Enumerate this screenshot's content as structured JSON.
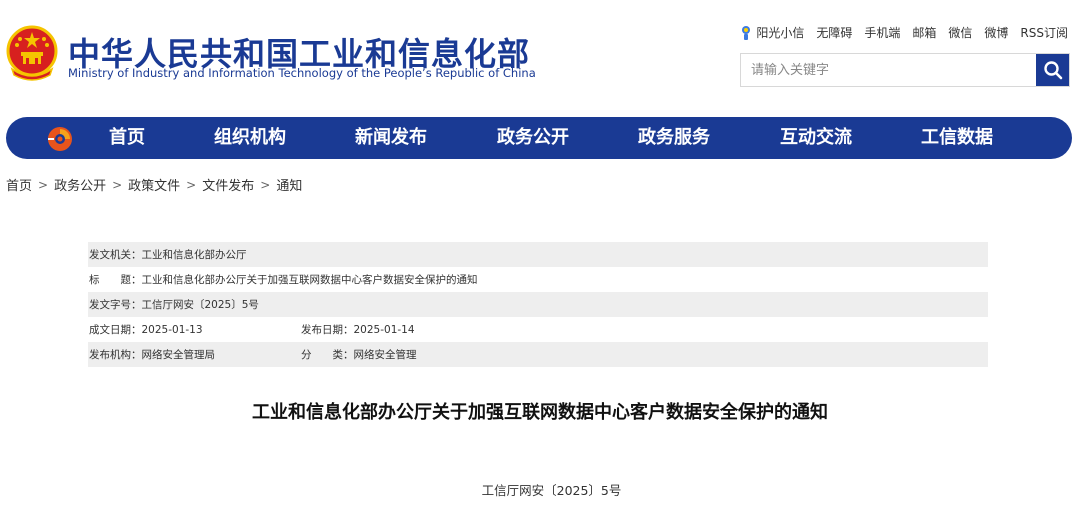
{
  "header": {
    "site_title": "中华人民共和国工业和信息化部",
    "site_subtitle": "Ministry of Industry and Information Technology of the People’s Republic of China",
    "top_links": [
      "阳光小信",
      "无障碍",
      "手机端",
      "邮箱",
      "微信",
      "微博",
      "RSS订阅"
    ],
    "search_placeholder": "请输入关键字"
  },
  "nav": {
    "items": [
      "首页",
      "组织机构",
      "新闻发布",
      "政务公开",
      "政务服务",
      "互动交流",
      "工信数据"
    ]
  },
  "breadcrumb": [
    "首页",
    "政务公开",
    "政策文件",
    "文件发布",
    "通知"
  ],
  "meta": {
    "issuer": "发文机关：工业和信息化部办公厅",
    "title": "标　　题：工业和信息化部办公厅关于加强互联网数据中心客户数据安全保护的通知",
    "doc_no": "发文字号：工信厅网安〔2025〕5号",
    "created_date": "成文日期：2025-01-13",
    "publish_date": "发布日期：2025-01-14",
    "publisher": "发布机构：网络安全管理局",
    "category": "分　　类：网络安全管理"
  },
  "document": {
    "title": "工业和信息化部办公厅关于加强互联网数据中心客户数据安全保护的通知",
    "number": "工信厅网安〔2025〕5号"
  },
  "colors": {
    "brand_blue": "#1a3a94",
    "emblem_red": "#d7201f",
    "emblem_gold": "#f5c400",
    "row_shade": "#eeeeee"
  },
  "icons": {
    "emblem": "national-emblem-icon",
    "sun": "sunshine-mascot-icon",
    "search": "search-icon",
    "nav_logo": "miit-logo-icon"
  }
}
